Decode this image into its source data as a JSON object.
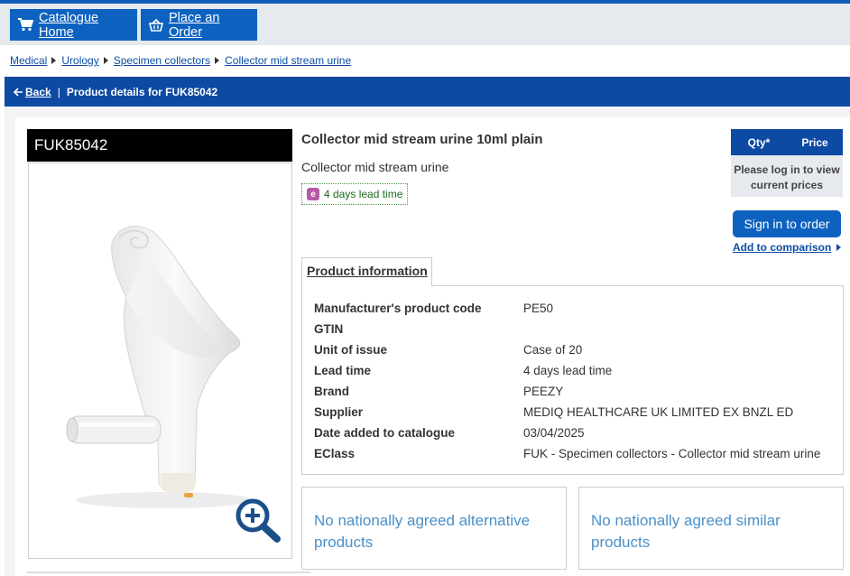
{
  "nav": {
    "home_label": "Catalogue Home",
    "order_label": "Place an Order",
    "home_icon": "shopping-cart-icon",
    "order_icon": "basket-icon"
  },
  "breadcrumb": [
    "Medical",
    "Urology",
    "Specimen collectors",
    "Collector mid stream urine"
  ],
  "titlebar": {
    "back_label": "Back",
    "title": "Product details for FUK85042"
  },
  "product": {
    "code": "FUK85042",
    "title": "Collector mid stream urine 10ml plain",
    "subtitle": "Collector mid stream urine",
    "lead_time_badge": "4 days lead time",
    "lead_icon_letter": "e"
  },
  "pricing": {
    "qty_header": "Qty*",
    "price_header": "Price",
    "message": "Please log in to view current prices",
    "signin_label": "Sign in to order",
    "compare_label": "Add to comparison"
  },
  "info_tab": {
    "label": "Product information",
    "rows": [
      {
        "key": "Manufacturer's product code",
        "value": "PE50"
      },
      {
        "key": "GTIN",
        "value": ""
      },
      {
        "key": "Unit of issue",
        "value": "Case of 20"
      },
      {
        "key": "Lead time",
        "value": "4 days lead time"
      },
      {
        "key": "Brand",
        "value": "PEEZY"
      },
      {
        "key": "Supplier",
        "value": "MEDIQ HEALTHCARE UK LIMITED EX BNZL ED"
      },
      {
        "key": "Date added to catalogue",
        "value": "03/04/2025"
      },
      {
        "key": "EClass",
        "value": "FUK - Specimen collectors - Collector mid stream urine"
      }
    ]
  },
  "alternatives": {
    "alt_text": "No nationally agreed alternative products",
    "similar_text": "No nationally agreed similar products"
  },
  "colors": {
    "brand_blue": "#0e62bf",
    "header_blue": "#0d4aa3",
    "link_blue": "#0b4ea2",
    "lead_green": "#1d6b1d",
    "muted_blue_text": "#4a90c8"
  }
}
